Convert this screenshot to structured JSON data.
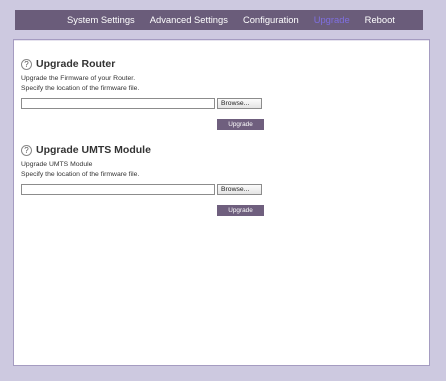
{
  "nav": {
    "items": [
      {
        "label": "System Settings"
      },
      {
        "label": "Advanced Settings"
      },
      {
        "label": "Configuration"
      },
      {
        "label": "Upgrade",
        "active": true
      },
      {
        "label": "Reboot"
      }
    ]
  },
  "router_section": {
    "title": "Upgrade Router",
    "description": "Upgrade the Firmware of your Router.",
    "instruction": "Specify the location of the firmware file.",
    "file_value": "",
    "browse_label": "Browse...",
    "upgrade_label": "Upgrade",
    "help_symbol": "?"
  },
  "umts_section": {
    "title": "Upgrade UMTS Module",
    "description": "Upgrade UMTS Module",
    "instruction": "Specify the location of the firmware file.",
    "file_value": "",
    "browse_label": "Browse...",
    "upgrade_label": "Upgrade",
    "help_symbol": "?"
  },
  "colors": {
    "background": "#cdc9e0",
    "nav_bg": "#6a5c7a",
    "nav_active_text": "#7f6fe0",
    "button_bg": "#6f5f7e"
  }
}
